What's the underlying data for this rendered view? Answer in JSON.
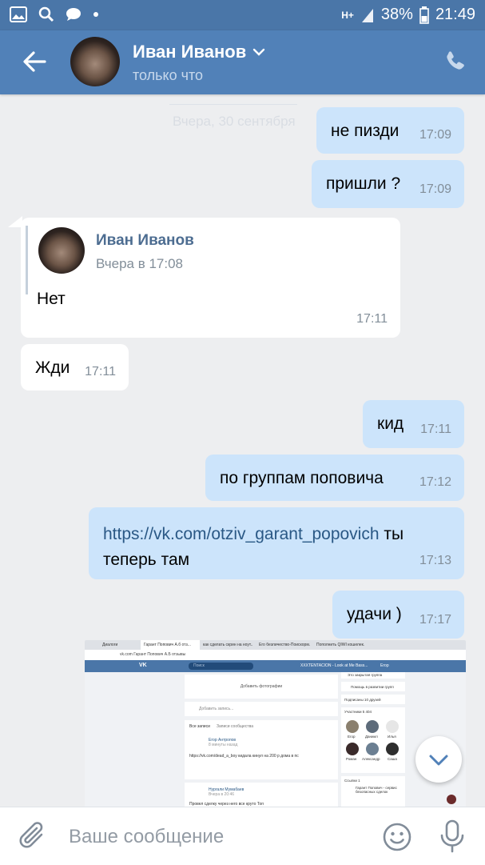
{
  "status_bar": {
    "battery": "38%",
    "time": "21:49",
    "network": "H+"
  },
  "header": {
    "name": "Иван Иванов",
    "status": "только что"
  },
  "chat": {
    "date_separator": "Вчера, 30 сентября",
    "messages": [
      {
        "dir": "out",
        "text": "не пизди",
        "time": "17:09"
      },
      {
        "dir": "out",
        "text": "пришли ?",
        "time": "17:09"
      },
      {
        "dir": "in",
        "forward": {
          "author": "Иван Иванов",
          "date": "Вчера в 17:08",
          "text": "Нет"
        },
        "time": "17:11"
      },
      {
        "dir": "in",
        "text": "Жди",
        "time": "17:11"
      },
      {
        "dir": "out",
        "text": "кид",
        "time": "17:11"
      },
      {
        "dir": "out",
        "text": "по группам поповича",
        "time": "17:12"
      },
      {
        "dir": "out",
        "link": "https://vk.com/otziv_garant_popovich",
        "text_after_link": " ты",
        "text_line2": "теперь там",
        "time": "17:13"
      },
      {
        "dir": "out",
        "text": "удачи )",
        "time": "17:17"
      }
    ]
  },
  "screenshot": {
    "tabs": [
      "Диалоги",
      "Гарант Попович А.б отз...",
      "как сделать скрин на ноут...",
      "Его безличество-Поискорм...",
      "Пополнить QIWI кошелек..."
    ],
    "address": "vk.com  Гарант Попович А.Б отзывы",
    "search_placeholder": "Поиск",
    "now_playing": "XXXTENTACION - Look at Me Bass...",
    "user": "Егор",
    "add_photo": "Добавить фотографии",
    "add_post": "Добавить запись...",
    "wall_tabs": [
      "Все записи",
      "Записи сообщества"
    ],
    "post1_author": "Егор Антропов",
    "post1_time": "8 минуты назад",
    "post1_text": "https://vk.com/dead_a_boy кидала кинул на 200 р дома в пс",
    "post2_author": "Нургали Мумабаев",
    "post2_time": "Вчера в 20:46",
    "post2_text": "Провел сделку через него все круто Топ",
    "side": {
      "closed_group": "Это закрытая группа",
      "help": "Помощь в развитии групп",
      "subs": "Подписаны 10 друзей",
      "members": "Участники 5 404",
      "member_names": [
        "Егор",
        "Даниил",
        "Илья",
        "Роман",
        "Александр",
        "Саша"
      ],
      "links": "Ссылки 1",
      "link_text": "Гарант Попович - сервис безопасных сделок"
    }
  },
  "composer": {
    "placeholder": "Ваше сообщение"
  },
  "colors": {
    "header": "#5181b8",
    "statusbar": "#4a76a8",
    "outgoing": "#cce4fb",
    "incoming": "#ffffff",
    "link": "#2a5885"
  }
}
